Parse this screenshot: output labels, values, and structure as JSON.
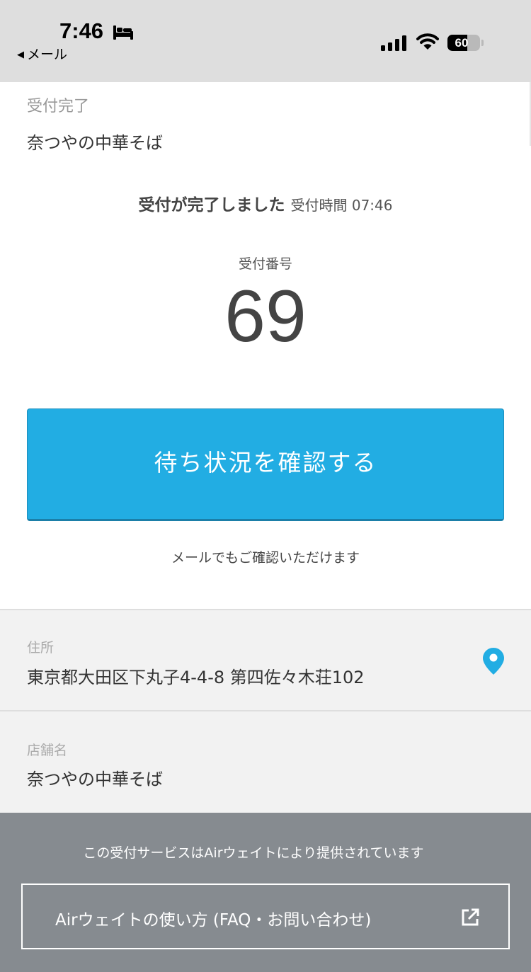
{
  "status_bar": {
    "time": "7:46",
    "back_label": "メール",
    "battery": "60",
    "battery_level": 0.6,
    "icons": [
      "bed-icon",
      "signal-icon",
      "wifi-icon",
      "battery-icon"
    ]
  },
  "header": {
    "status": "受付完了",
    "shop_name": "奈つやの中華そば"
  },
  "confirmation": {
    "title": "受付が完了しました",
    "time_label": "受付時間 07:46",
    "number_label": "受付番号",
    "number": "69"
  },
  "actions": {
    "check_status_label": "待ち状況を確認する",
    "mail_note": "メールでもご確認いただけます"
  },
  "info": {
    "address_label": "住所",
    "address": "東京都大田区下丸子4-4-8 第四佐々木荘102",
    "shop_label": "店舗名",
    "shop_name": "奈つやの中華そば"
  },
  "footer": {
    "note": "この受付サービスはAirウェイトにより提供されています",
    "faq_link": "Airウェイトの使い方 (FAQ・お問い合わせ)"
  },
  "colors": {
    "accent": "#22ade3",
    "footer_bg": "#868b90",
    "info_bg": "#f2f2f2",
    "status_bar_bg": "#dedede"
  }
}
